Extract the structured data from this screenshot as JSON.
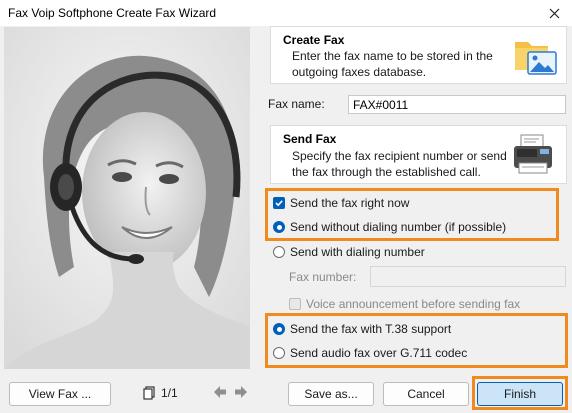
{
  "window": {
    "title": "Fax Voip Softphone Create Fax Wizard"
  },
  "create_fax": {
    "title": "Create Fax",
    "description_line1": "Enter the fax name to be stored in the",
    "description_line2": "outgoing faxes database.",
    "icon": "folder-image-icon"
  },
  "fax_name": {
    "label": "Fax name:",
    "value": "FAX#0011"
  },
  "send_fax": {
    "title": "Send Fax",
    "description_line1": "Specify the fax recipient number or send",
    "description_line2": "the fax through the established call.",
    "icon": "fax-machine-icon"
  },
  "options": {
    "send_right_now": {
      "label": "Send the fax right now",
      "checked": true
    },
    "send_without_dialing": {
      "label": "Send without dialing number (if possible)",
      "selected": true
    },
    "send_with_dialing": {
      "label": "Send with dialing number",
      "selected": false
    },
    "fax_number": {
      "label": "Fax number:",
      "value": ""
    },
    "voice_announcement": {
      "label": "Voice announcement before sending fax",
      "checked": false
    },
    "t38_support": {
      "label": "Send the fax with T.38 support",
      "selected": true
    },
    "g711_audio": {
      "label": "Send audio fax over G.711 codec",
      "selected": false
    }
  },
  "footer": {
    "view_fax_label": "View Fax ...",
    "page_indicator": "1/1",
    "save_as_label": "Save as...",
    "cancel_label": "Cancel",
    "finish_label": "Finish"
  },
  "colors": {
    "highlight": "#f08a1e",
    "accent": "#005fb8"
  }
}
